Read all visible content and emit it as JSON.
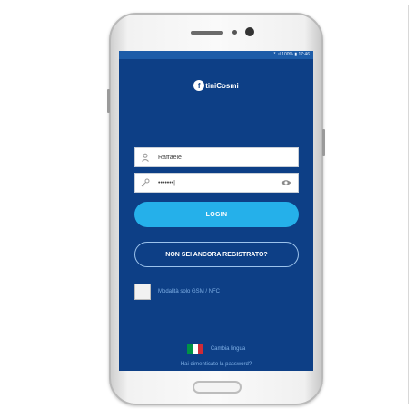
{
  "status_bar": {
    "text": "* .ıl 100% ▮ 17:46"
  },
  "logo": {
    "mark": "f",
    "text": "tiniCosmi"
  },
  "username_field": {
    "value": "Raffaele",
    "icon": "user-icon"
  },
  "password_field": {
    "value": "•••••••|",
    "icon": "key-icon",
    "toggle_icon": "eye-icon"
  },
  "login_button": {
    "label": "LOGIN"
  },
  "register_button": {
    "label": "NON SEI ANCORA REGISTRATO?"
  },
  "mode_checkbox": {
    "label": "Modalità solo GSM / NFC",
    "checked": false
  },
  "language": {
    "label": "Cambia lingua",
    "flag_colors": [
      "#009246",
      "#ffffff",
      "#ce2b37"
    ]
  },
  "forgot_password": {
    "label": "Hai dimenticato la password?"
  },
  "colors": {
    "screen_bg": "#0d3f86",
    "accent": "#25b0ea",
    "muted_text": "#7fb0e6"
  }
}
